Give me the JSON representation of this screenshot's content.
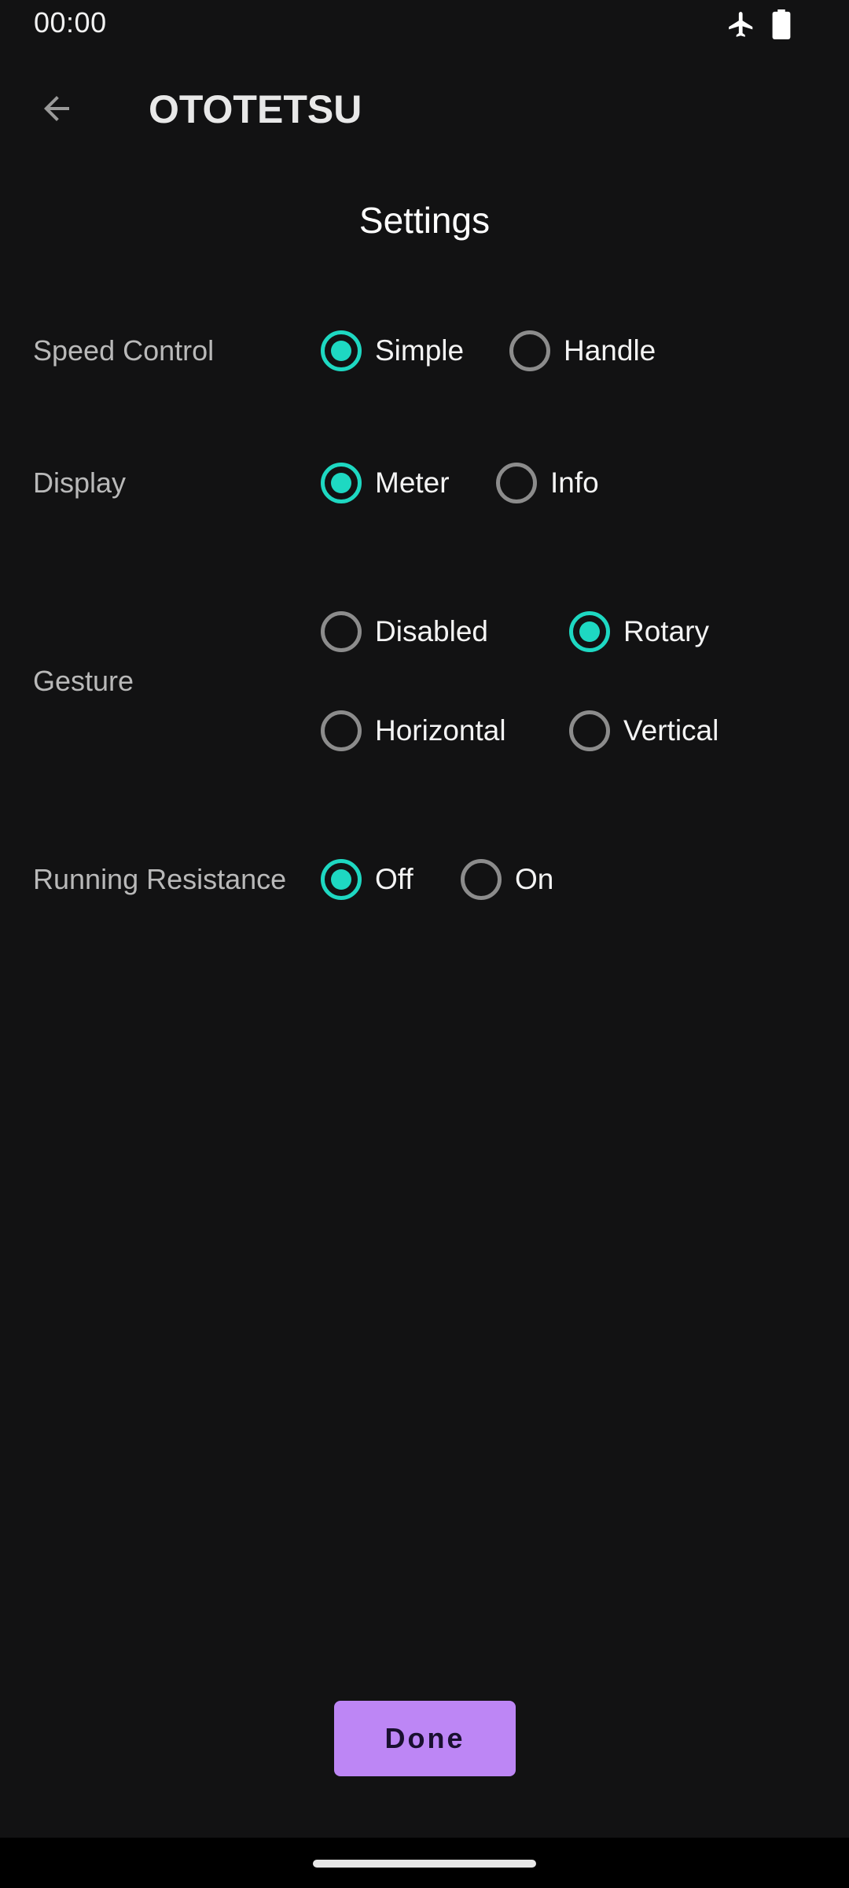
{
  "status_bar": {
    "time": "00:00",
    "icons": [
      "airplane-icon",
      "battery-icon"
    ]
  },
  "app_bar": {
    "back_icon": "arrow-back-icon",
    "title": "OTOTETSU"
  },
  "settings": {
    "title": "Settings",
    "speed_control": {
      "label": "Speed Control",
      "options": [
        {
          "label": "Simple",
          "selected": true
        },
        {
          "label": "Handle",
          "selected": false
        }
      ]
    },
    "display": {
      "label": "Display",
      "options": [
        {
          "label": "Meter",
          "selected": true
        },
        {
          "label": "Info",
          "selected": false
        }
      ]
    },
    "gesture": {
      "label": "Gesture",
      "options": [
        {
          "label": "Disabled",
          "selected": false
        },
        {
          "label": "Rotary",
          "selected": true
        },
        {
          "label": "Horizontal",
          "selected": false
        },
        {
          "label": "Vertical",
          "selected": false
        }
      ]
    },
    "running_resistance": {
      "label": "Running Resistance",
      "options": [
        {
          "label": "Off",
          "selected": true
        },
        {
          "label": "On",
          "selected": false
        }
      ]
    }
  },
  "footer": {
    "done_label": "Done"
  },
  "colors": {
    "background": "#121213",
    "accent": "#1ed8c2",
    "button": "#bd86f5"
  }
}
